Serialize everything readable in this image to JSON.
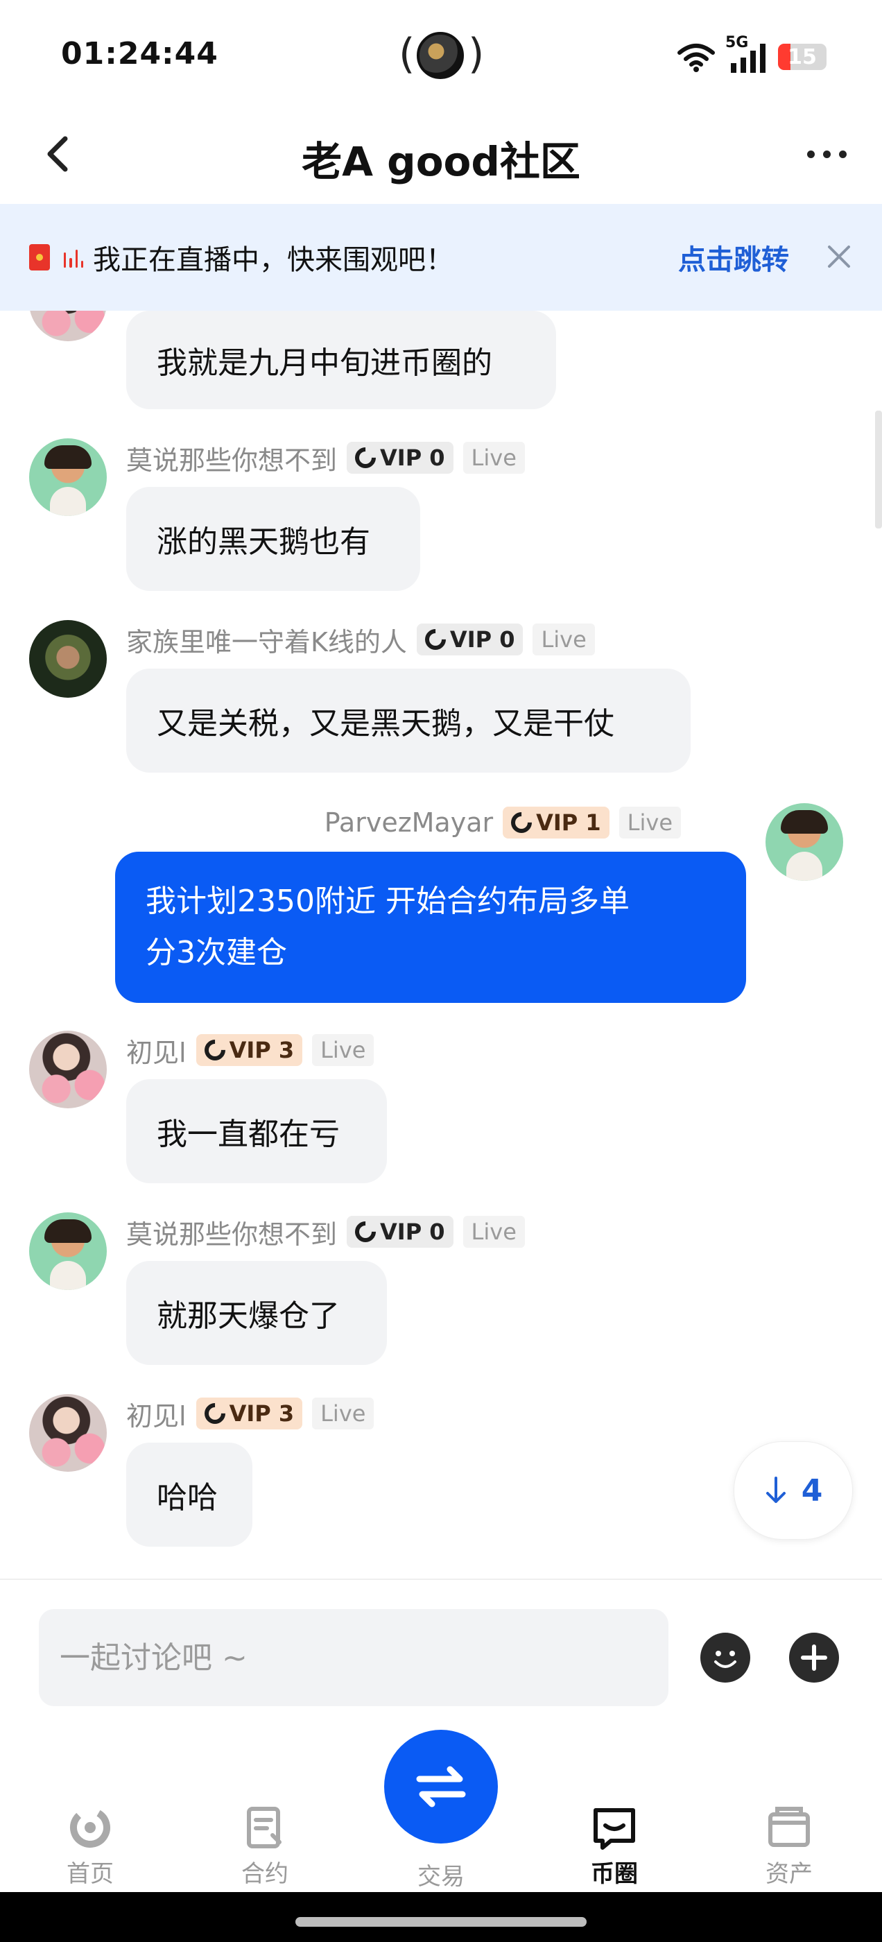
{
  "status_bar": {
    "time": "01:24:44",
    "network": "5G",
    "battery": "15"
  },
  "nav": {
    "title": "老A good社区"
  },
  "live_banner": {
    "text": "我正在直播中，快来围观吧！",
    "jump_label": "点击跳转"
  },
  "messages": [
    {
      "text": "我就是九月中旬进币圈的"
    },
    {
      "user": "莫说那些你想不到",
      "vip": "VIP 0",
      "live": "Live",
      "text": "涨的黑天鹅也有"
    },
    {
      "user": "家族里唯一守着K线的人",
      "vip": "VIP 0",
      "live": "Live",
      "text": "又是关税，又是黑天鹅，又是干仗"
    },
    {
      "user": "ParvezMayar",
      "vip": "VIP 1",
      "live": "Live",
      "text_line1": "我计划2350附近 开始合约布局多单",
      "text_line2": "分3次建仓"
    },
    {
      "user": "初见l",
      "vip": "VIP 3",
      "live": "Live",
      "text": "我一直都在亏"
    },
    {
      "user": "莫说那些你想不到",
      "vip": "VIP 0",
      "live": "Live",
      "text": "就那天爆仓了"
    },
    {
      "user": "初见l",
      "vip": "VIP 3",
      "live": "Live",
      "text": "哈哈"
    }
  ],
  "new_messages": {
    "count": "4"
  },
  "input": {
    "placeholder": "一起讨论吧 ~"
  },
  "tabs": [
    {
      "label": "首页"
    },
    {
      "label": "合约"
    },
    {
      "label": "交易"
    },
    {
      "label": "币圈"
    },
    {
      "label": "资产"
    }
  ],
  "colors": {
    "accent": "#0a5bf4",
    "banner_bg": "#eaf2fe",
    "link": "#1f5fd6"
  }
}
